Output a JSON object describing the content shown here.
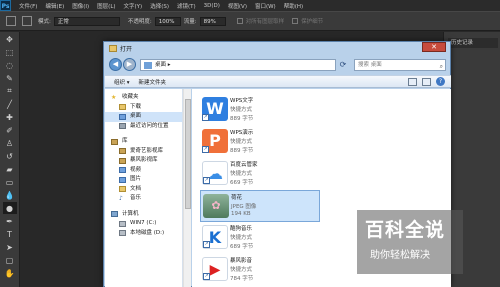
{
  "app": {
    "logo": "Ps"
  },
  "menubar": {
    "items": [
      "文件(F)",
      "编辑(E)",
      "图像(I)",
      "图层(L)",
      "文字(Y)",
      "选择(S)",
      "滤镜(T)",
      "3D(D)",
      "视图(V)",
      "窗口(W)",
      "帮助(H)"
    ]
  },
  "options": {
    "mode_label": "模式:",
    "mode_value": "正常",
    "opacity_label": "不透明度:",
    "opacity_value": "100%",
    "flow_label": "流量:",
    "flow_value": "89%",
    "option1": "对所有图层取样",
    "option2": "保护细节"
  },
  "rightpanel": {
    "tab": "历史记录"
  },
  "dialog": {
    "title": "打开",
    "address": "桌面",
    "search_placeholder": "搜索 桌面",
    "organize": "组织 ▾",
    "new_folder": "新建文件夹"
  },
  "nav": {
    "favorites": "收藏夹",
    "fav_items": [
      "下载",
      "桌面",
      "最近访问的位置"
    ],
    "libraries": "库",
    "lib_items": [
      "爱奇艺影视库",
      "暴风影视库",
      "视频",
      "图片",
      "文档",
      "音乐"
    ],
    "computer": "计算机",
    "computer_items": [
      "WIN7 (C:)",
      "本地磁盘 (D:)"
    ]
  },
  "files": [
    {
      "name": "WPS文字",
      "type": "快捷方式",
      "size": "889 字节",
      "icon": "wps-writer-icon",
      "color": "#2f7fe0"
    },
    {
      "name": "WPS演示",
      "type": "快捷方式",
      "size": "889 字节",
      "icon": "wps-presentation-icon",
      "color": "#f07039"
    },
    {
      "name": "百度云管家",
      "type": "快捷方式",
      "size": "669 字节",
      "icon": "baidu-cloud-icon",
      "color": "#3a8ee6"
    },
    {
      "name": "荷花",
      "type": "JPEG 图像",
      "size": "194 KB",
      "icon": "lotus-image-thumbnail",
      "color": "#5f8a6b"
    },
    {
      "name": "酷狗音乐",
      "type": "快捷方式",
      "size": "689 字节",
      "icon": "kugou-music-icon",
      "color": "#1a6fd1"
    },
    {
      "name": "暴风影音",
      "type": "快捷方式",
      "size": "784 字节",
      "icon": "baofeng-player-icon",
      "color": "#d22"
    }
  ],
  "watermark": {
    "title": "百科全说",
    "subtitle": "助你轻松解决"
  }
}
